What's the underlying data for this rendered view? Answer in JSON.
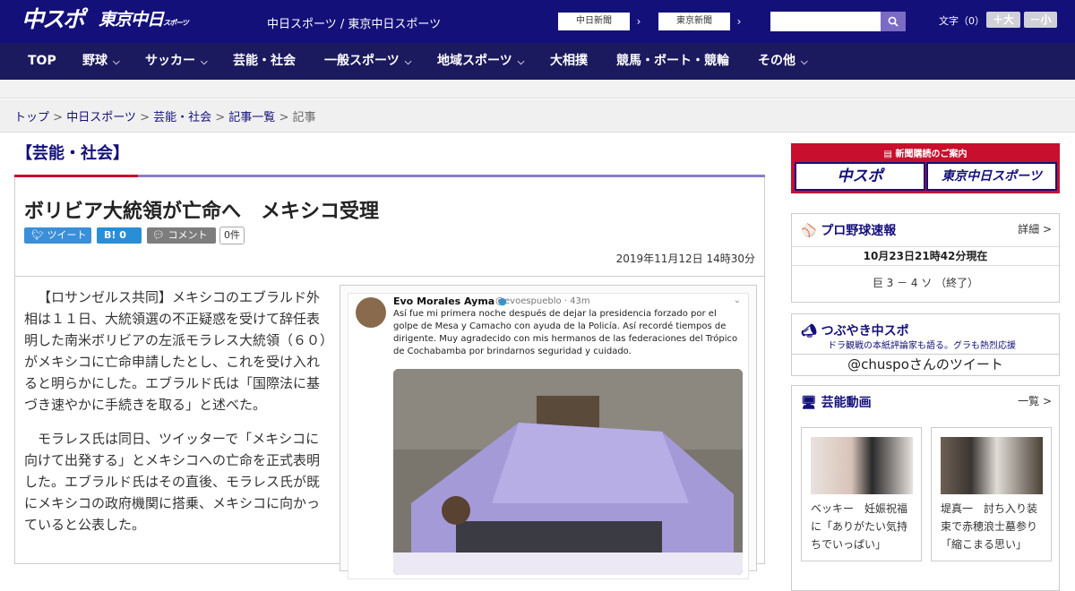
{
  "header": {
    "logo_chuspo": "中スポ",
    "logo_tokyo": "東京中日",
    "logo_tokyo_suffix": "スポーツ",
    "tagline": "中日スポーツ / 東京中日スポーツ",
    "btn_chunichi": "中日新聞",
    "btn_tokyo": "東京新聞",
    "search_placeholder": "",
    "font_label": "文字（0）",
    "font_bigger": "＋大",
    "font_smaller": "－小"
  },
  "nav": [
    {
      "label": "TOP",
      "dropdown": false
    },
    {
      "label": "野球",
      "dropdown": true
    },
    {
      "label": "サッカー",
      "dropdown": true
    },
    {
      "label": "芸能・社会",
      "dropdown": false
    },
    {
      "label": "一般スポーツ",
      "dropdown": true
    },
    {
      "label": "地域スポーツ",
      "dropdown": true
    },
    {
      "label": "大相撲",
      "dropdown": false
    },
    {
      "label": "競馬・ボート・競輪",
      "dropdown": false
    },
    {
      "label": "その他",
      "dropdown": true
    }
  ],
  "breadcrumb": {
    "items": [
      "トップ",
      "中日スポーツ",
      "芸能・社会",
      "記事一覧"
    ],
    "current": "記事"
  },
  "category": "【芸能・社会】",
  "article": {
    "headline": "ボリビア大統領が亡命へ　メキシコ受理",
    "tweet_label": "ツイート",
    "hatena_label": "B!",
    "hatena_count": "0",
    "comment_label": "コメント",
    "comment_count": "0件",
    "date": "2019年11月12日 14時30分",
    "paragraphs": [
      "【ロサンゼルス共同】メキシコのエブラルド外相は１１日、大統領選の不正疑惑を受けて辞任表明した南米ボリビアの左派モラレス大統領（６０）がメキシコに亡命申請したとし、これを受け入れると明らかにした。エブラルド氏は「国際法に基づき速やかに手続きを取る」と述べた。",
      "モラレス氏は同日、ツイッターで「メキシコに向けて出発する」とメキシコへの亡命を正式表明した。エブラルド氏はその直後、モラレス氏が既にメキシコの政府機関に搭乗、メキシコに向かっていると公表した。"
    ]
  },
  "embedded_tweet": {
    "name": "Evo Morales Ayma",
    "handle": "@evoespueblo · 43m",
    "text": "Así fue mi primera noche después de dejar la presidencia forzado por el golpe de Mesa y Camacho con ayuda de la Policía. Así recordé tiempos de dirigente. Muy agradecido con mis hermanos de las federaciones del Trópico de Cochabamba por brindarnos seguridad y cuidado."
  },
  "sidebar": {
    "subscribe_title": "新聞購読のご案内",
    "sub_logo1": "中スポ",
    "sub_logo2": "東京中日スポーツ",
    "baseball_title": "プロ野球速報",
    "baseball_more": "詳細 >",
    "baseball_time": "10月23日21時42分現在",
    "baseball_score": "巨 3 － 4 ソ （終了）",
    "tsubuyaki_title": "つぶやき中スポ",
    "tsubuyaki_sub": "ドラ観戦の本紙評論家も語る。グラも熱烈応援",
    "tsubuyaki_handle": "@chuspoさんのツイート",
    "video_title": "芸能動画",
    "video_more": "一覧 >",
    "videos": [
      {
        "caption": "ベッキー　妊娠祝福に「ありがたい気持ちでいっぱい」"
      },
      {
        "caption": "堤真一　討ち入り装束で赤穂浪士墓参り「縮こまる思い」"
      }
    ]
  },
  "colors": {
    "header_bg": "#14107a",
    "nav_bg": "#1c1a5e",
    "accent_red": "#c8102e",
    "accent_purple": "#8a7ec8"
  }
}
